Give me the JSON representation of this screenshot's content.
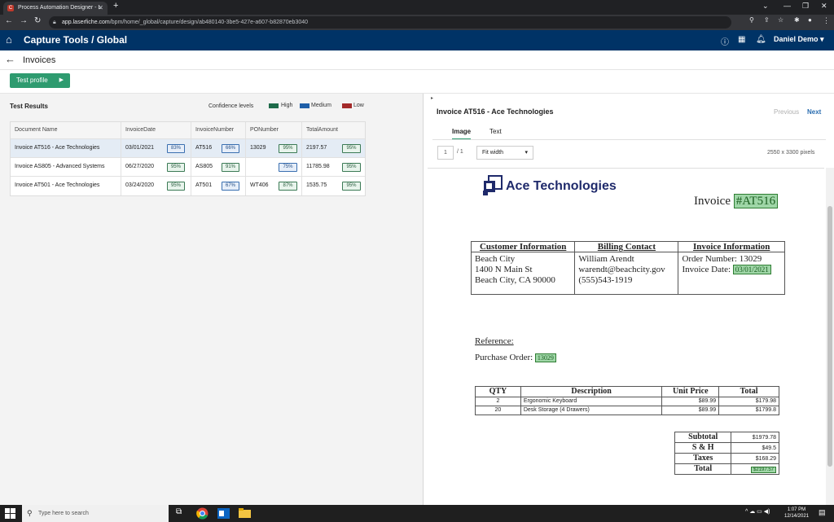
{
  "browser": {
    "tab_title": "Process Automation Designer - L",
    "url_host": "app.laserfiche.com",
    "url_path": "/bpm/home/_global/capture/design/ab480140-3be5-427e-a607-b82870eb3040"
  },
  "app": {
    "title": "Capture Tools / Global",
    "user": "Daniel Demo ▾"
  },
  "page": {
    "title": "Invoices",
    "test_button": "Test profile"
  },
  "results": {
    "title": "Test Results",
    "confidence_label": "Confidence levels",
    "legend": [
      {
        "label": "High",
        "color": "#1e6b4a"
      },
      {
        "label": "Medium",
        "color": "#1f5fa8"
      },
      {
        "label": "Low",
        "color": "#a32a2a"
      }
    ],
    "columns": [
      "Document Name",
      "InvoiceDate",
      "InvoiceNumber",
      "PONumber",
      "TotalAmount"
    ],
    "rows": [
      {
        "name": "Invoice AT516 - Ace Technologies",
        "date": "03/01/2021",
        "date_conf": "83%",
        "number": "AT516",
        "number_conf": "66%",
        "po": "13029",
        "po_conf": "95%",
        "total": "2197.57",
        "total_conf": "95%"
      },
      {
        "name": "Invoice AS805 - Advanced Systems",
        "date": "06/27/2020",
        "date_conf": "95%",
        "number": "AS805",
        "number_conf": "91%",
        "po": "",
        "po_conf": "75%",
        "total": "11785.98",
        "total_conf": "95%"
      },
      {
        "name": "Invoice AT501 - Ace Technologies",
        "date": "03/24/2020",
        "date_conf": "95%",
        "number": "AT501",
        "number_conf": "67%",
        "po": "WT406",
        "po_conf": "87%",
        "total": "1535.75",
        "total_conf": "95%"
      }
    ]
  },
  "preview": {
    "title": "Invoice AT516 - Ace Technologies",
    "previous": "Previous",
    "next": "Next",
    "tab_image": "Image",
    "tab_text": "Text",
    "page_number": "1",
    "page_total": "/ 1",
    "fit": "Fit width",
    "dimensions": "2550 x 3300 pixels"
  },
  "invoice": {
    "company": "Ace Technologies",
    "heading": "Invoice",
    "number": "#AT516",
    "customer_header": "Customer Information",
    "billing_header": "Billing Contact",
    "info_header": "Invoice Information",
    "customer_lines": [
      "Beach City",
      "1400 N Main St",
      "Beach City, CA 90000"
    ],
    "billing_lines": [
      "William Arendt",
      "warendt@beachcity.gov",
      "(555)543-1919"
    ],
    "order_number": "Order Number: 13029",
    "invoice_date_label": "Invoice Date:",
    "invoice_date": "03/01/2021",
    "reference": "Reference:",
    "po_label": "Purchase Order:",
    "po_value": "13029",
    "items_headers": [
      "QTY",
      "Description",
      "Unit Price",
      "Total"
    ],
    "items": [
      {
        "qty": "2",
        "desc": "Ergonomic Keyboard",
        "unit": "$89.99",
        "total": "$179.98"
      },
      {
        "qty": "20",
        "desc": "Desk Storage (4 Drawers)",
        "unit": "$89.99",
        "total": "$1799.8"
      }
    ],
    "totals": [
      {
        "label": "Subtotal",
        "value": "$1979.78"
      },
      {
        "label": "S & H",
        "value": "$49.5"
      },
      {
        "label": "Taxes",
        "value": "$168.29"
      },
      {
        "label": "Total",
        "value": "$2197.57"
      }
    ]
  },
  "taskbar": {
    "search_placeholder": "Type here to search",
    "time": "1:07 PM",
    "date": "12/14/2021"
  }
}
